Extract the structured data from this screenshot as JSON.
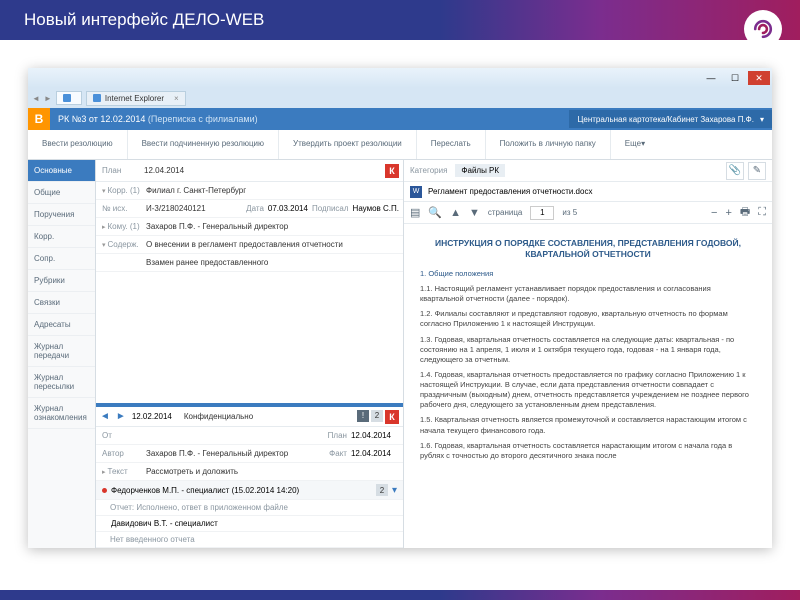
{
  "slide_title": "Новый интерфейс ДЕЛО-WEB",
  "ie": {
    "tab1": "",
    "tab2": "Internet Explorer"
  },
  "app": {
    "logo": "В",
    "doc_title": "РК №3 от 12.02.2014",
    "doc_sub": "(Переписка с филиалами)",
    "context": "Центральная картотека/Кабинет Захарова П.Ф."
  },
  "toolbar": {
    "b1": "Ввести резолюцию",
    "b2": "Ввести подчиненную резолюцию",
    "b3": "Утвердить проект резолюции",
    "b4": "Переслать",
    "b5": "Положить в личную папку",
    "b6": "Еще"
  },
  "sidebar": [
    "Основные",
    "Общие",
    "Поручения",
    "Корр.",
    "Сопр.",
    "Рубрики",
    "Связки",
    "Адресаты",
    "Журнал передачи",
    "Журнал пересылки",
    "Журнал ознакомления"
  ],
  "sidebar_active": 0,
  "form": {
    "plan_lbl": "План",
    "plan_val": "12.04.2014",
    "korr_lbl": "Корр. (1)",
    "korr_val": "Филиал г. Санкт-Петербург",
    "nish_lbl": "№ исх.",
    "nish_val": "И-3/2180240121",
    "date_lbl": "Дата",
    "date_val": "07.03.2014",
    "sign_lbl": "Подписал",
    "sign_val": "Наумов С.П.",
    "komu_lbl": "Кому. (1)",
    "komu_val": "Захаров П.Ф. - Генеральный директор",
    "sod_lbl": "Содерж.",
    "sod_val": "О внесении в регламент предоставления отчетности",
    "extra": "Взамен ранее предоставленного"
  },
  "resolution": {
    "date_nav": "12.02.2014",
    "conf": "Конфиденциально",
    "plan_lbl": "План",
    "plan_val": "12.04.2014",
    "author_lbl": "Автор",
    "author_val": "Захаров П.Ф. - Генеральный директор",
    "fact_lbl": "Факт",
    "fact_val": "12.04.2014",
    "text_lbl": "Текст",
    "text_val": "Рассмотреть и доложить",
    "rep1": "Федорченков М.П. - специалист (15.02.2014  14:20)",
    "rep1_sub": "Отчет: Исполнено, ответ в приложенном файле",
    "rep2": "Давидович В.Т. - специалист",
    "rep2_sub": "Нет введенного отчета"
  },
  "files": {
    "cat_lbl": "Категория",
    "cat_val": "Файлы РК",
    "filename": "Регламент предоставления отчетности.docx",
    "page_lbl": "страница",
    "page_val": "1",
    "page_total": "из 5"
  },
  "doc": {
    "title": "ИНСТРУКЦИЯ О ПОРЯДКЕ СОСТАВЛЕНИЯ, ПРЕДСТАВЛЕНИЯ ГОДОВОЙ, КВАРТАЛЬНОЙ ОТЧЕТНОСТИ",
    "s1": "1. Общие положения",
    "p11": "1.1. Настоящий регламент устанавливает порядок предоставления и согласования квартальной отчетности (далее - порядок).",
    "p12": "1.2. Филиалы составляют и представляют годовую, квартальную отчетность по формам согласно Приложению 1 к настоящей Инструкции.",
    "p13": "1.3. Годовая, квартальная отчетность составляется на следующие даты: квартальная - по состоянию на 1 апреля, 1 июля и 1 октября текущего года, годовая - на 1 января года, следующего за отчетным.",
    "p14": "1.4. Годовая, квартальная отчетность предоставляется по графику согласно Приложению 1 к настоящей Инструкции. В случае, если дата представления отчетности совпадает с праздничным (выходным) днем, отчетность представляется учреждением не позднее первого рабочего дня, следующего за установленным днем представления.",
    "p15": "1.5. Квартальная отчетность является промежуточной и составляется нарастающим итогом с начала текущего финансового года.",
    "p16": "1.6. Годовая, квартальная отчетность составляется нарастающим итогом с начала года в рублях с точностью до второго десятичного знака после"
  }
}
